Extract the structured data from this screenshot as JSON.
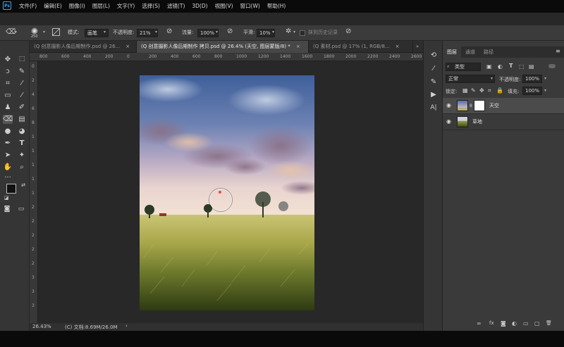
{
  "app": {
    "logo_text": "Ps"
  },
  "menu": [
    "文件(F)",
    "编辑(E)",
    "图像(I)",
    "图层(L)",
    "文字(Y)",
    "选择(S)",
    "滤镜(T)",
    "3D(D)",
    "视图(V)",
    "窗口(W)",
    "帮助(H)"
  ],
  "options_bar": {
    "brush_size": "250",
    "mode_label": "模式:",
    "mode_value": "画笔",
    "opacity_label": "不透明度:",
    "opacity_value": "21%",
    "flow_label": "流量:",
    "flow_value": "100%",
    "smoothing_label": "平滑:",
    "smoothing_value": "10%",
    "history_label": "抹到历史记录"
  },
  "doc_tabs": [
    {
      "label": "(Q 创意摄影人像后期制作.psd @ 26...",
      "close": "×"
    },
    {
      "label": "(Q 创意摄影人像后期制作 拷贝.psd @ 26.4% (天空, 图层蒙版/8) *",
      "close": "×"
    },
    {
      "label": "(Q 素材.psd @ 17% (1, RGB/8...",
      "close": "×"
    }
  ],
  "ruler": {
    "top": [
      "800",
      "600",
      "400",
      "200",
      "0",
      "200",
      "400",
      "600",
      "800",
      "1000",
      "1200",
      "1400",
      "1600",
      "1800",
      "2000",
      "2200",
      "2400",
      "2600"
    ],
    "left": [
      "0",
      "2",
      "4",
      "6",
      "8",
      "1",
      "1",
      "1",
      "1",
      "1",
      "2",
      "2",
      "2",
      "2",
      "2",
      "3",
      "3",
      "3"
    ]
  },
  "status": {
    "zoom": "26.43%",
    "doc_info": "(C) 文档:8.69M/26.0M",
    "arrow": "›"
  },
  "layers_panel": {
    "tabs": [
      "图层",
      "通道",
      "路径"
    ],
    "menu_icon": "≡",
    "filter_label": "类型",
    "blend_mode": "正常",
    "opacity_label": "不透明度:",
    "opacity_value": "100%",
    "lock_label": "锁定:",
    "fill_label": "填充:",
    "fill_value": "100%",
    "layers": [
      {
        "name": "天空",
        "selected": true
      },
      {
        "name": "草地",
        "selected": false
      }
    ],
    "footer_icons": [
      "link-icon",
      "fx-icon",
      "mask-icon",
      "adjustment-icon",
      "folder-icon",
      "new-layer-icon",
      "trash-icon"
    ],
    "footer_glyphs": [
      "∞",
      "fx",
      "◙",
      "◐",
      "▭",
      "▢",
      "🗑"
    ]
  },
  "colors": {
    "foreground": "#111111",
    "background": "#ffffff",
    "accent": "#3da2ef"
  }
}
